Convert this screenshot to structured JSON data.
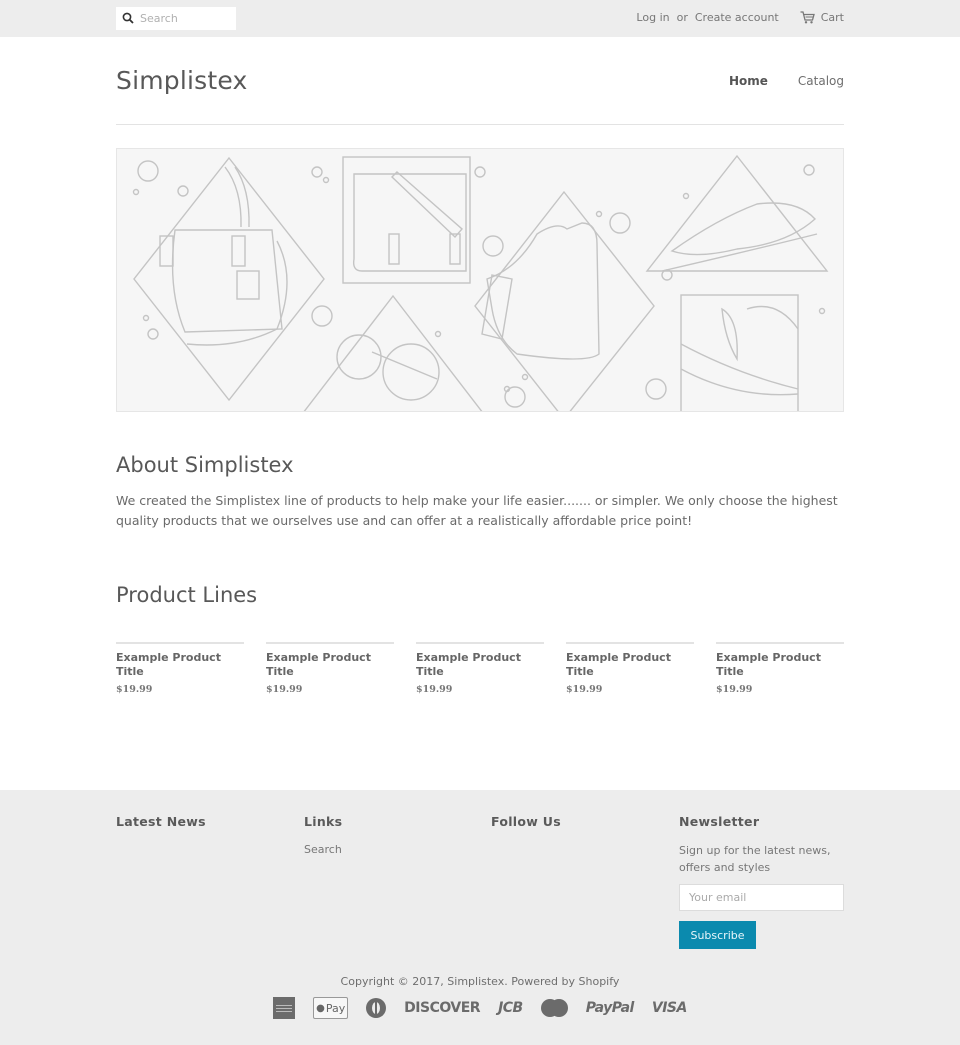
{
  "topbar": {
    "search_placeholder": "Search",
    "login_label": "Log in",
    "or_label": "or",
    "create_account_label": "Create account",
    "cart_label": "Cart"
  },
  "header": {
    "logo": "Simplistex",
    "nav": [
      {
        "label": "Home",
        "active": true
      },
      {
        "label": "Catalog",
        "active": false
      }
    ]
  },
  "hero": {
    "alt": "Line-art illustration of bags, shoes, glasses and accessories"
  },
  "about": {
    "title": "About Simplistex",
    "text": "We created the Simplistex line of products to help make your life easier....... or simpler. We only choose the highest quality products that we ourselves use and can offer at a realistically affordable price point!"
  },
  "product_lines": {
    "title": "Product Lines",
    "products": [
      {
        "title": "Example Product Title",
        "price": "$19.99"
      },
      {
        "title": "Example Product Title",
        "price": "$19.99"
      },
      {
        "title": "Example Product Title",
        "price": "$19.99"
      },
      {
        "title": "Example Product Title",
        "price": "$19.99"
      },
      {
        "title": "Example Product Title",
        "price": "$19.99"
      }
    ]
  },
  "footer": {
    "latest_news": {
      "title": "Latest News"
    },
    "links": {
      "title": "Links",
      "items": [
        "Search"
      ]
    },
    "follow_us": {
      "title": "Follow Us"
    },
    "newsletter": {
      "title": "Newsletter",
      "text": "Sign up for the latest news, offers and styles",
      "email_placeholder": "Your email",
      "subscribe_label": "Subscribe"
    },
    "copyright_prefix": "Copyright © 2017, ",
    "copyright_store": "Simplistex",
    "copyright_sep": ". ",
    "powered_by": "Powered by Shopify",
    "payments": [
      "american-express",
      "apple-pay",
      "diners-club",
      "discover",
      "jcb",
      "master",
      "paypal",
      "visa"
    ],
    "payment_labels": {
      "apple_pay": "Pay",
      "discover": "DISCOVER",
      "jcb": "JCB",
      "paypal": "PayPal",
      "visa": "VISA"
    }
  },
  "colors": {
    "accent": "#0b8aae",
    "topbar_bg": "#ededed",
    "footer_bg": "#ededed",
    "text": "#585858"
  }
}
